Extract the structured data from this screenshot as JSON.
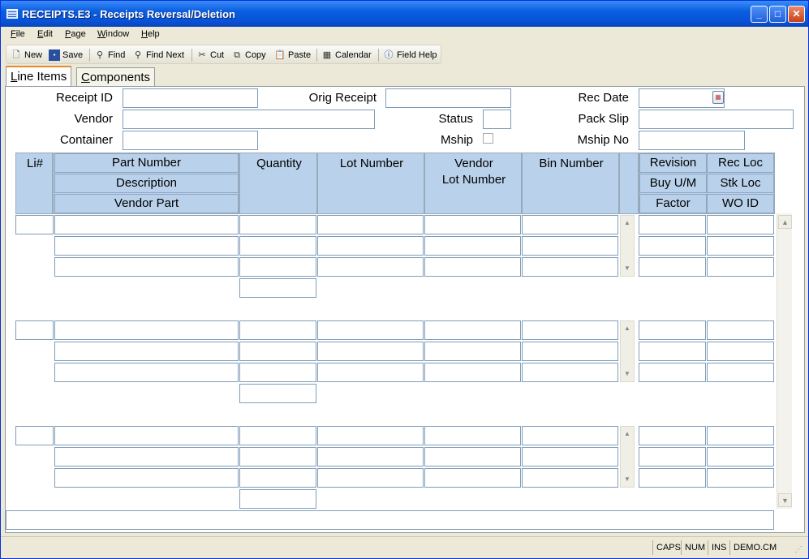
{
  "window": {
    "title": "RECEIPTS.E3 - Receipts Reversal/Deletion",
    "minimize": "_",
    "maximize": "□",
    "close": "✕"
  },
  "menu": [
    {
      "label": "File",
      "key": "F",
      "rest": "ile"
    },
    {
      "label": "Edit",
      "key": "E",
      "rest": "dit"
    },
    {
      "label": "Page",
      "key": "P",
      "rest": "age"
    },
    {
      "label": "Window",
      "key": "W",
      "rest": "indow"
    },
    {
      "label": "Help",
      "key": "H",
      "rest": "elp"
    }
  ],
  "toolbar": {
    "new": "New",
    "save": "Save",
    "find": "Find",
    "find_next": "Find Next",
    "cut": "Cut",
    "copy": "Copy",
    "paste": "Paste",
    "calendar": "Calendar",
    "field_help": "Field Help"
  },
  "tabs": {
    "line_items": "Line Items",
    "line_items_key": "L",
    "line_items_rest": "ine Items",
    "components": "Components",
    "components_key": "C",
    "components_rest": "omponents"
  },
  "form": {
    "receipt_id": "Receipt ID",
    "orig_receipt": "Orig Receipt",
    "rec_date": "Rec Date",
    "vendor": "Vendor",
    "status": "Status",
    "pack_slip": "Pack Slip",
    "container": "Container",
    "mship": "Mship",
    "mship_no": "Mship No"
  },
  "grid_headers": {
    "li": "Li#",
    "part_number": "Part Number",
    "description": "Description",
    "vendor_part": "Vendor Part",
    "quantity": "Quantity",
    "lot_number": "Lot Number",
    "vendor_lot_1": "Vendor",
    "vendor_lot_2": "Lot Number",
    "bin_number": "Bin Number",
    "revision": "Revision",
    "rec_loc": "Rec Loc",
    "buy_um": "Buy U/M",
    "stk_loc": "Stk Loc",
    "factor": "Factor",
    "wo_id": "WO ID"
  },
  "statusbar": {
    "caps": "CAPS",
    "num": "NUM",
    "ins": "INS",
    "account": "DEMO.CM"
  }
}
